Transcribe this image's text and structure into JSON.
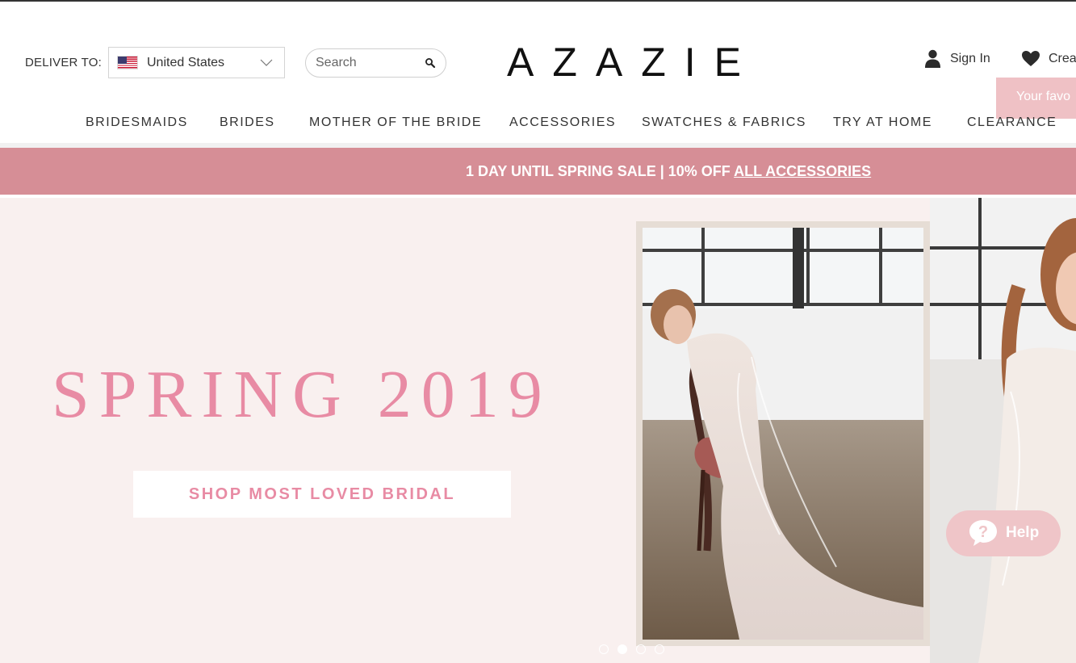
{
  "header": {
    "deliver_label": "DELIVER TO:",
    "country": "United States",
    "search_placeholder": "Search",
    "logo": "AZAZIE",
    "signin_label": "Sign In",
    "create_label": "Crea",
    "favorites_tip": "Your favo"
  },
  "nav": {
    "items": [
      {
        "label": "BRIDESMAIDS"
      },
      {
        "label": "BRIDES"
      },
      {
        "label": "MOTHER OF THE BRIDE"
      },
      {
        "label": "ACCESSORIES"
      },
      {
        "label": "SWATCHES & FABRICS"
      },
      {
        "label": "TRY AT HOME"
      },
      {
        "label": "CLEARANCE"
      }
    ]
  },
  "promo": {
    "text": "1 DAY UNTIL SPRING SALE | 10% OFF ",
    "link": "ALL ACCESSORIES"
  },
  "hero": {
    "title": "SPRING 2019",
    "cta": "SHOP MOST LOVED BRIDAL",
    "slide_count": 4,
    "active_slide": 2
  },
  "help": {
    "label": "Help"
  },
  "colors": {
    "brand_pink": "#d68e96",
    "hero_pink": "#e88ba4",
    "hero_bg": "#f9f0ef",
    "tip_pink": "#efc1c5"
  }
}
